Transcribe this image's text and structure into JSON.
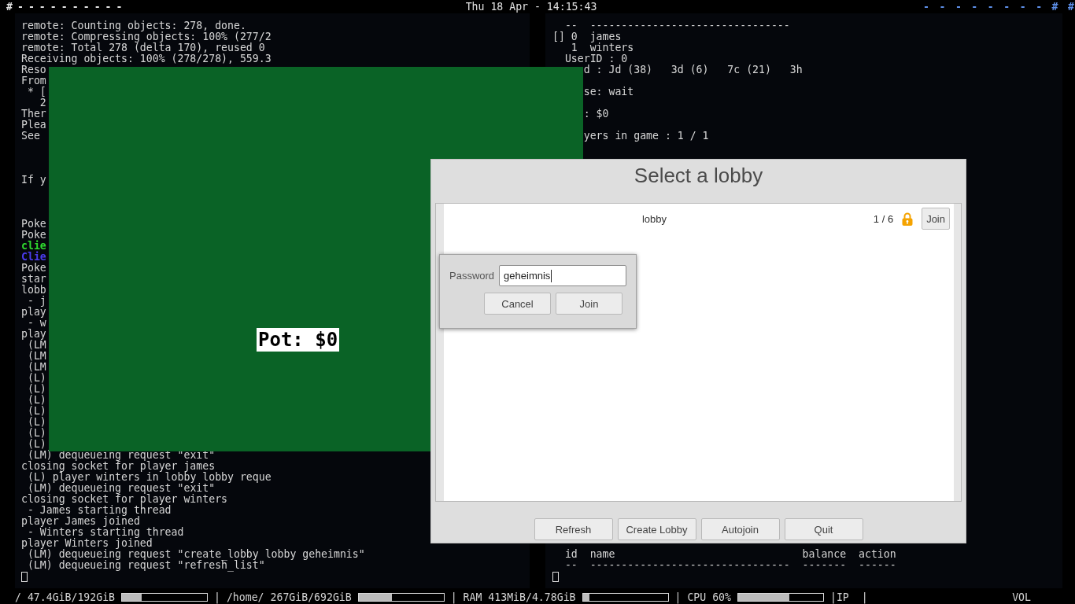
{
  "top_bar": {
    "left_tags": [
      "#",
      "-",
      "-",
      "-",
      "-",
      "-",
      "-",
      "-",
      "-",
      "-",
      "-"
    ],
    "clock": "Thu 18 Apr - 14:15:43",
    "right_tags": [
      "-",
      "-",
      "-",
      "-",
      "-",
      "-",
      "-",
      "-",
      "#",
      "#"
    ]
  },
  "terminals": [
    {
      "lines": [
        {
          "kind": "text",
          "text": "remote: Counting objects: 278, done."
        },
        {
          "kind": "text",
          "text": "remote: Compressing objects: 100% (277/2"
        },
        {
          "kind": "text",
          "text": "remote: Total 278 (delta 170), reused 0"
        },
        {
          "kind": "text",
          "text": "Receiving objects: 100% (278/278), 559.3"
        },
        {
          "kind": "text",
          "text": "Reso"
        },
        {
          "kind": "text",
          "text": "From"
        },
        {
          "kind": "text",
          "text": " * ["
        },
        {
          "kind": "text",
          "text": "   2"
        },
        {
          "kind": "text",
          "text": "Ther"
        },
        {
          "kind": "text",
          "text": "Plea"
        },
        {
          "kind": "text",
          "text": "See"
        },
        {
          "kind": "blank"
        },
        {
          "kind": "blank"
        },
        {
          "kind": "blank"
        },
        {
          "kind": "text",
          "text": "If y"
        },
        {
          "kind": "blank"
        },
        {
          "kind": "blank"
        },
        {
          "kind": "blank"
        },
        {
          "kind": "text",
          "text": "Poke"
        },
        {
          "kind": "text",
          "text": "Poke"
        },
        {
          "kind": "text",
          "text": "clie",
          "color": "#2fdc2f"
        },
        {
          "kind": "text",
          "text": "Clie",
          "color": "#4b3cf0"
        },
        {
          "kind": "text",
          "text": "Poke"
        },
        {
          "kind": "text",
          "text": "star"
        },
        {
          "kind": "text",
          "text": "lobb"
        },
        {
          "kind": "text",
          "text": " - j"
        },
        {
          "kind": "text",
          "text": "play"
        },
        {
          "kind": "text",
          "text": " - w"
        },
        {
          "kind": "text",
          "text": "play"
        },
        {
          "kind": "text",
          "text": " (LM"
        },
        {
          "kind": "text",
          "text": " (LM"
        },
        {
          "kind": "text",
          "text": " (LM"
        },
        {
          "kind": "text",
          "text": " (L)"
        },
        {
          "kind": "text",
          "text": " (L)"
        },
        {
          "kind": "text",
          "text": " (L)"
        },
        {
          "kind": "text",
          "text": " (L)"
        },
        {
          "kind": "text",
          "text": " (L)"
        },
        {
          "kind": "text",
          "text": " (L)"
        },
        {
          "kind": "text",
          "text": " (L)"
        },
        {
          "kind": "text",
          "text": " (LM) dequeueing request \"exit\""
        },
        {
          "kind": "text",
          "text": "closing socket for player james"
        },
        {
          "kind": "text",
          "text": " (L) player winters in lobby lobby reque"
        },
        {
          "kind": "text",
          "text": " (LM) dequeueing request \"exit\""
        },
        {
          "kind": "text",
          "text": "closing socket for player winters"
        },
        {
          "kind": "text",
          "text": " - James starting thread"
        },
        {
          "kind": "text",
          "text": "player James joined"
        },
        {
          "kind": "text",
          "text": " - Winters starting thread"
        },
        {
          "kind": "text",
          "text": "player Winters joined"
        },
        {
          "kind": "text",
          "text": " (LM) dequeueing request \"create_lobby lobby geheimnis\""
        },
        {
          "kind": "text",
          "text": " (LM) dequeueing request \"refresh_list\""
        },
        {
          "kind": "cursor"
        }
      ]
    },
    {
      "lines": [
        {
          "kind": "text",
          "text": "  --  --------------------------------"
        },
        {
          "kind": "text",
          "text": "[] 0  james"
        },
        {
          "kind": "text",
          "text": "   1  winters"
        },
        {
          "kind": "text",
          "text": "  UserID : 0"
        },
        {
          "kind": "text",
          "text": "     d : Jd (38)   3d (6)   7c (21)   3h"
        },
        {
          "kind": "blank"
        },
        {
          "kind": "text",
          "text": "     se: wait"
        },
        {
          "kind": "blank"
        },
        {
          "kind": "text",
          "text": "     : $0"
        },
        {
          "kind": "blank"
        },
        {
          "kind": "text",
          "text": "     yers in game : 1 / 1"
        }
      ],
      "footer_lines": [
        {
          "kind": "text",
          "text": "  id  name                              balance  action"
        },
        {
          "kind": "text",
          "text": "  --  --------------------------------  -------  ------"
        },
        {
          "kind": "cursor"
        }
      ]
    }
  ],
  "game_window": {
    "pot_label": "Pot: $0"
  },
  "lobby_dialog": {
    "title": "Select a lobby",
    "lobbies": [
      {
        "name": "lobby",
        "players": "1 / 6",
        "locked": true,
        "join_button": "Join"
      }
    ],
    "buttons": [
      "Refresh",
      "Create Lobby",
      "Autojoin",
      "Quit"
    ]
  },
  "password_popup": {
    "label": "Password",
    "value": "geheimnis",
    "buttons": [
      "Cancel",
      "Join"
    ]
  },
  "status_bar": {
    "items": [
      {
        "kind": "text",
        "text": "/ 47.4GiB/192GiB"
      },
      {
        "kind": "meter",
        "level": 0.23
      },
      {
        "kind": "text",
        "text": "| /home/ 267GiB/692GiB"
      },
      {
        "kind": "meter",
        "level": 0.39
      },
      {
        "kind": "text",
        "text": "| RAM 413MiB/4.78GiB"
      },
      {
        "kind": "meter",
        "level": 0.08
      },
      {
        "kind": "text",
        "text": "| CPU 60%"
      },
      {
        "kind": "meter",
        "level": 0.6
      },
      {
        "kind": "text",
        "text": "|IP  |"
      }
    ],
    "volume": "VOL"
  }
}
